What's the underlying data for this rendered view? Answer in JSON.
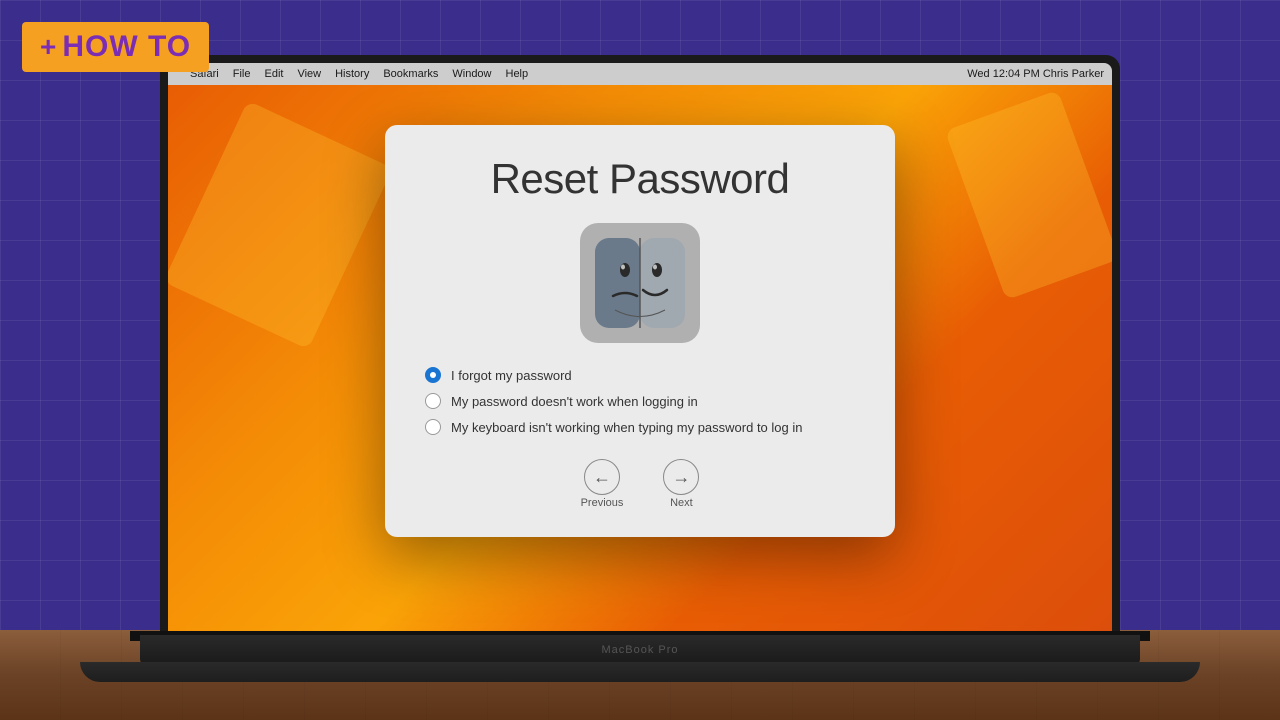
{
  "badge": {
    "plus": "+",
    "text": "HOW TO"
  },
  "menubar": {
    "apple": "",
    "items": [
      "Safari",
      "File",
      "Edit",
      "View",
      "History",
      "Bookmarks",
      "Window",
      "Help"
    ],
    "status": "Wed 12:04 PM  Chris Parker"
  },
  "dialog": {
    "title": "Reset Password",
    "finder_alt": "Finder icon",
    "options": [
      {
        "id": "opt1",
        "label": "I forgot my password",
        "selected": true
      },
      {
        "id": "opt2",
        "label": "My password doesn't work when logging in",
        "selected": false
      },
      {
        "id": "opt3",
        "label": "My keyboard isn't working when typing my password to log in",
        "selected": false
      }
    ],
    "nav": {
      "previous_label": "Previous",
      "next_label": "Next",
      "previous_arrow": "←",
      "next_arrow": "→"
    }
  },
  "laptop": {
    "brand": "MacBook Pro"
  },
  "colors": {
    "badge_bg": "#f5a020",
    "badge_text": "#7b2db5",
    "radio_selected": "#1a75d2",
    "dialog_bg": "#ebebeb"
  }
}
